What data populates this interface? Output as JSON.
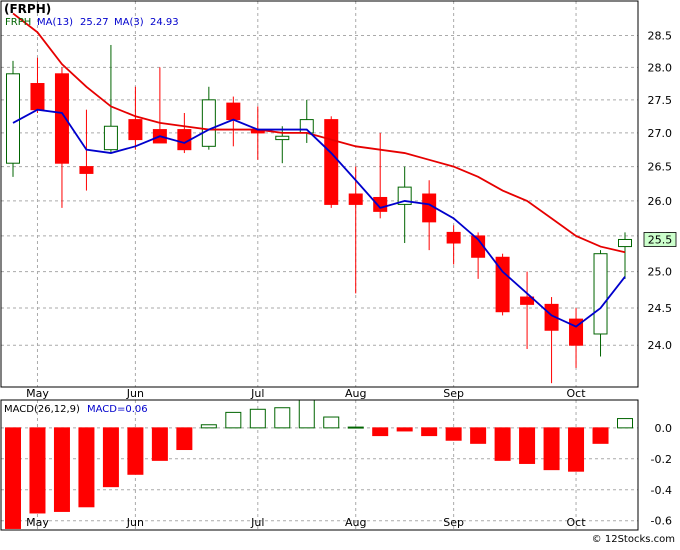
{
  "price_panel": {
    "ticker_label": "(FRPH)",
    "legend": [
      {
        "text": "FRPH",
        "color": "#006400"
      },
      {
        "text": "MA(13)",
        "color": "#0000cc"
      },
      {
        "text": "25.27",
        "color": "#0000cc"
      },
      {
        "text": "MA(3)",
        "color": "#0000cc"
      },
      {
        "text": "24.93",
        "color": "#0000cc"
      }
    ],
    "last_price_label": "25.5"
  },
  "macd_panel": {
    "legend": [
      {
        "text": "MACD(26,12,9)",
        "color": "#000000"
      },
      {
        "text": "MACD=0.06",
        "color": "#0000cc"
      }
    ]
  },
  "footer": {
    "copyright": "© 12Stocks.com"
  },
  "colors": {
    "up": "#006400",
    "down": "#ff0000",
    "ma13": "#e60000",
    "ma3": "#0000cc",
    "grid": "#aaaaaa",
    "tag_bg": "#ccffcc"
  },
  "chart_data": [
    {
      "type": "candlestick",
      "title": "(FRPH)",
      "x_tick_labels": [
        "May",
        "Jun",
        "Jul",
        "Aug",
        "Sep",
        "Oct"
      ],
      "y_tick_labels": [
        "24.0",
        "24.5",
        "25.0",
        "25.5",
        "26.0",
        "26.5",
        "27.0",
        "27.5",
        "28.0",
        "28.5"
      ],
      "ylim": [
        23.45,
        29.05
      ],
      "scale": "log",
      "grid": true,
      "weeks": 26,
      "month_label_weeks": [
        1,
        5,
        10,
        14,
        18,
        23
      ],
      "candles": [
        {
          "week": 0,
          "open": 26.55,
          "high": 28.1,
          "low": 26.35,
          "close": 27.9
        },
        {
          "week": 1,
          "open": 27.75,
          "high": 28.15,
          "low": 27.3,
          "close": 27.35
        },
        {
          "week": 2,
          "open": 27.9,
          "high": 28.0,
          "low": 25.9,
          "close": 26.55
        },
        {
          "week": 3,
          "open": 26.5,
          "high": 27.35,
          "low": 26.15,
          "close": 26.4
        },
        {
          "week": 4,
          "open": 26.75,
          "high": 28.35,
          "low": 26.7,
          "close": 27.1
        },
        {
          "week": 5,
          "open": 27.2,
          "high": 27.7,
          "low": 26.75,
          "close": 26.9
        },
        {
          "week": 6,
          "open": 27.05,
          "high": 28.0,
          "low": 26.85,
          "close": 26.85
        },
        {
          "week": 7,
          "open": 27.05,
          "high": 27.3,
          "low": 26.7,
          "close": 26.75
        },
        {
          "week": 8,
          "open": 26.8,
          "high": 27.7,
          "low": 26.75,
          "close": 27.5
        },
        {
          "week": 9,
          "open": 27.45,
          "high": 27.55,
          "low": 26.8,
          "close": 27.2
        },
        {
          "week": 10,
          "open": 27.05,
          "high": 27.4,
          "low": 26.6,
          "close": 27.0
        },
        {
          "week": 11,
          "open": 26.9,
          "high": 27.1,
          "low": 26.55,
          "close": 26.95
        },
        {
          "week": 12,
          "open": 27.0,
          "high": 27.5,
          "low": 26.85,
          "close": 27.2
        },
        {
          "week": 13,
          "open": 27.2,
          "high": 27.25,
          "low": 25.9,
          "close": 25.95
        },
        {
          "week": 14,
          "open": 26.1,
          "high": 26.5,
          "low": 24.7,
          "close": 25.95
        },
        {
          "week": 15,
          "open": 26.05,
          "high": 27.0,
          "low": 25.75,
          "close": 25.85
        },
        {
          "week": 16,
          "open": 25.95,
          "high": 26.5,
          "low": 25.4,
          "close": 26.2
        },
        {
          "week": 17,
          "open": 26.1,
          "high": 26.3,
          "low": 25.3,
          "close": 25.7
        },
        {
          "week": 18,
          "open": 25.55,
          "high": 25.65,
          "low": 25.1,
          "close": 25.4
        },
        {
          "week": 19,
          "open": 25.5,
          "high": 25.55,
          "low": 24.9,
          "close": 25.2
        },
        {
          "week": 20,
          "open": 25.2,
          "high": 25.25,
          "low": 24.4,
          "close": 24.45
        },
        {
          "week": 21,
          "open": 24.65,
          "high": 25.0,
          "low": 23.95,
          "close": 24.55
        },
        {
          "week": 22,
          "open": 24.55,
          "high": 24.65,
          "low": 23.5,
          "close": 24.2
        },
        {
          "week": 23,
          "open": 24.35,
          "high": 24.5,
          "low": 23.7,
          "close": 24.0
        },
        {
          "week": 24,
          "open": 24.15,
          "high": 25.3,
          "low": 23.85,
          "close": 25.25
        },
        {
          "week": 25,
          "open": 25.35,
          "high": 25.55,
          "low": 24.9,
          "close": 25.45
        }
      ],
      "series": [
        {
          "name": "MA(13)",
          "points": [
            [
              0,
              28.85
            ],
            [
              1,
              28.55
            ],
            [
              2,
              28.05
            ],
            [
              3,
              27.7
            ],
            [
              4,
              27.4
            ],
            [
              5,
              27.25
            ],
            [
              6,
              27.15
            ],
            [
              7,
              27.1
            ],
            [
              8,
              27.05
            ],
            [
              9,
              27.05
            ],
            [
              10,
              27.05
            ],
            [
              11,
              27.0
            ],
            [
              12,
              27.0
            ],
            [
              13,
              26.9
            ],
            [
              14,
              26.8
            ],
            [
              15,
              26.75
            ],
            [
              16,
              26.7
            ],
            [
              17,
              26.6
            ],
            [
              18,
              26.5
            ],
            [
              19,
              26.35
            ],
            [
              20,
              26.15
            ],
            [
              21,
              26.0
            ],
            [
              22,
              25.75
            ],
            [
              23,
              25.5
            ],
            [
              24,
              25.35
            ],
            [
              25,
              25.27
            ]
          ]
        },
        {
          "name": "MA(3)",
          "points": [
            [
              0,
              27.15
            ],
            [
              1,
              27.35
            ],
            [
              2,
              27.3
            ],
            [
              3,
              26.75
            ],
            [
              4,
              26.7
            ],
            [
              5,
              26.8
            ],
            [
              6,
              26.95
            ],
            [
              7,
              26.85
            ],
            [
              8,
              27.05
            ],
            [
              9,
              27.2
            ],
            [
              10,
              27.05
            ],
            [
              11,
              27.05
            ],
            [
              12,
              27.05
            ],
            [
              13,
              26.7
            ],
            [
              14,
              26.3
            ],
            [
              15,
              25.9
            ],
            [
              16,
              26.0
            ],
            [
              17,
              25.95
            ],
            [
              18,
              25.75
            ],
            [
              19,
              25.45
            ],
            [
              20,
              25.0
            ],
            [
              21,
              24.7
            ],
            [
              22,
              24.4
            ],
            [
              23,
              24.25
            ],
            [
              24,
              24.5
            ],
            [
              25,
              24.93
            ]
          ]
        }
      ]
    },
    {
      "type": "bar",
      "title": "MACD(26,12,9)",
      "x_tick_labels": [
        "May",
        "Jun",
        "Jul",
        "Aug",
        "Sep",
        "Oct"
      ],
      "y_tick_labels": [
        "0.0",
        "-0.2",
        "-0.4",
        "-0.6"
      ],
      "ylim": [
        -0.66,
        0.18
      ],
      "grid": true,
      "weeks": 26,
      "month_label_weeks": [
        1,
        5,
        10,
        14,
        18,
        23
      ],
      "values": [
        -0.65,
        -0.55,
        -0.54,
        -0.51,
        -0.38,
        -0.3,
        -0.21,
        -0.14,
        0.02,
        0.1,
        0.12,
        0.13,
        0.18,
        0.07,
        0.005,
        -0.05,
        -0.02,
        -0.05,
        -0.08,
        -0.1,
        -0.21,
        -0.23,
        -0.27,
        -0.28,
        -0.1,
        0.06
      ]
    }
  ]
}
